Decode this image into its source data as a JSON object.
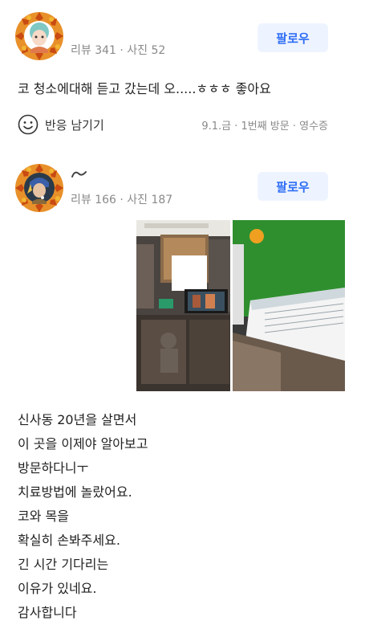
{
  "reviews": [
    {
      "meta": "리뷰 341 · 사진 52",
      "follow_label": "팔로우",
      "text": "코 청소에대해 듣고 갔는데 오.....ㅎㅎㅎ 좋아요",
      "reaction_label": "반응 남기기",
      "visit_info": "9.1.금 · 1번째 방문 · 영수증"
    },
    {
      "meta": "리뷰 166 · 사진 187",
      "follow_label": "팔로우",
      "body_lines": [
        "신사동 20년을 살면서",
        "이 곳을 이제야 알아보고",
        "방문하다니ㅜ",
        "치료방법에 놀랐어요.",
        "코와 목을",
        "확실히 손봐주세요.",
        "긴 시간 기다리는",
        "이유가 있네요.",
        "감사합니다"
      ]
    }
  ],
  "icons": {
    "reaction": "smile-icon"
  },
  "colors": {
    "accent": "#2e6df6",
    "follow_bg": "#eef4ff",
    "meta_gray": "#8a8a8a"
  }
}
